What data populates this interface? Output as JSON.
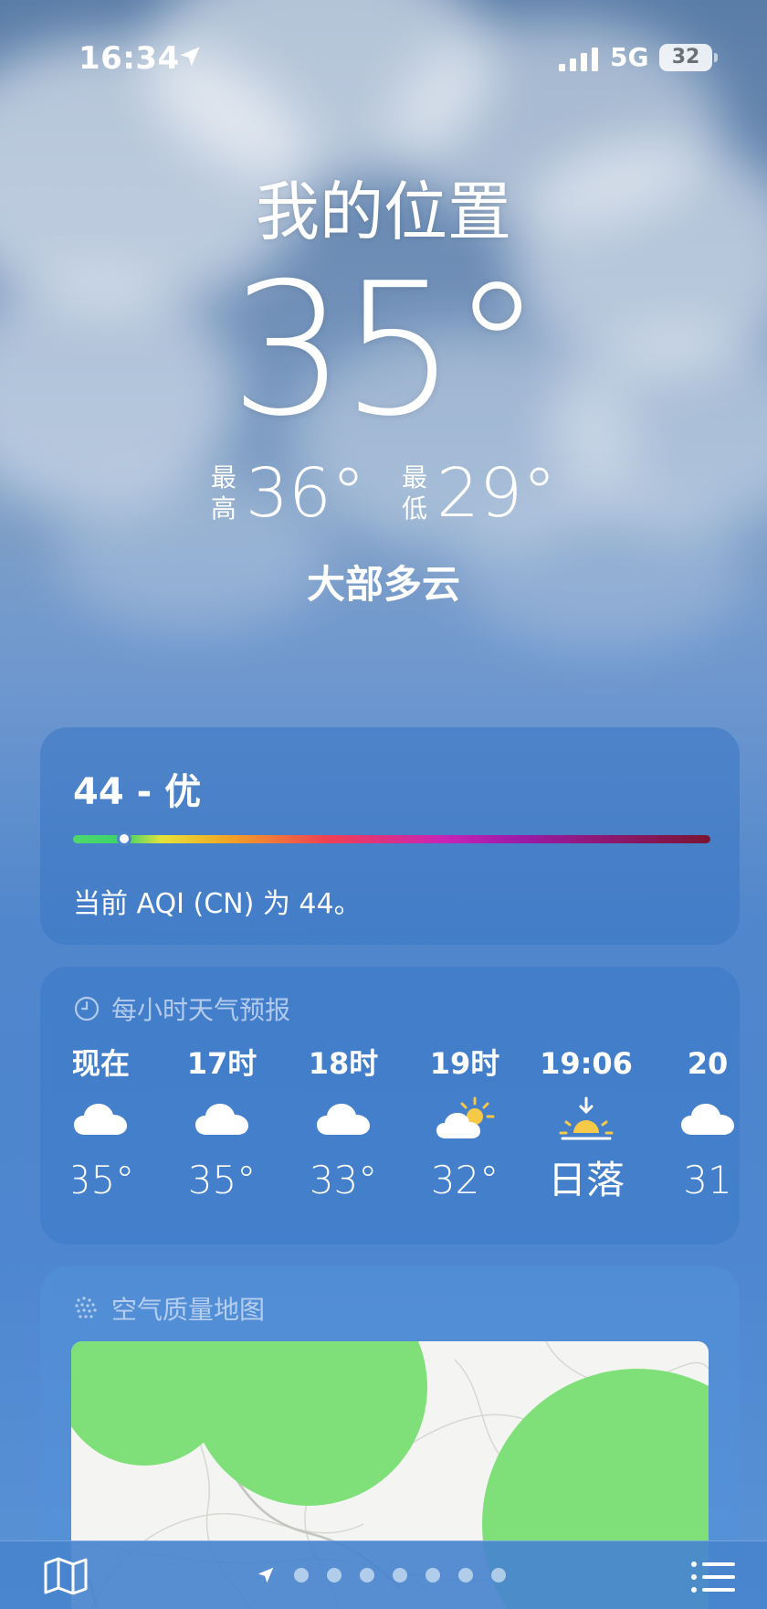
{
  "status_bar": {
    "time": "16:34",
    "network": "5G",
    "battery": "32"
  },
  "header": {
    "location": "我的位置",
    "temperature": "35°",
    "high_label_1": "最",
    "high_label_2": "高",
    "high_value": "36°",
    "low_label_1": "最",
    "low_label_2": "低",
    "low_value": "29°",
    "condition": "大部多云"
  },
  "aqi": {
    "value_text": "44 - 优",
    "description": "当前 AQI (CN) 为 44。",
    "indicator_fraction": 0.08,
    "scale_colors": [
      "#4fd86c",
      "#e6e23a",
      "#f2a624",
      "#f03f54",
      "#c824b6",
      "#9b1ba8",
      "#7a1532"
    ]
  },
  "hourly": {
    "title": "每小时天气预报",
    "title_icon": "clock-icon",
    "items": [
      {
        "label": "现在",
        "icon": "cloud-icon",
        "temp": "35°"
      },
      {
        "label": "17时",
        "icon": "cloud-icon",
        "temp": "35°"
      },
      {
        "label": "18时",
        "icon": "cloud-icon",
        "temp": "33°"
      },
      {
        "label": "19时",
        "icon": "partly-sunny-icon",
        "temp": "32°"
      },
      {
        "label": "19:06",
        "icon": "sunset-icon",
        "temp": "日落"
      },
      {
        "label": "20",
        "icon": "cloud-icon",
        "temp": "31"
      }
    ]
  },
  "air_map": {
    "title": "空气质量地图",
    "title_icon": "air-quality-icon"
  },
  "bottom_bar": {
    "map_button": "map-icon",
    "location_indicator": "location-arrow-icon",
    "page_count": 7,
    "list_button": "list-icon"
  },
  "colors": {
    "aqi_good": "#4fd86c",
    "map_aqi_fill": "#7fe07a",
    "sun_yellow": "#f7c948"
  }
}
